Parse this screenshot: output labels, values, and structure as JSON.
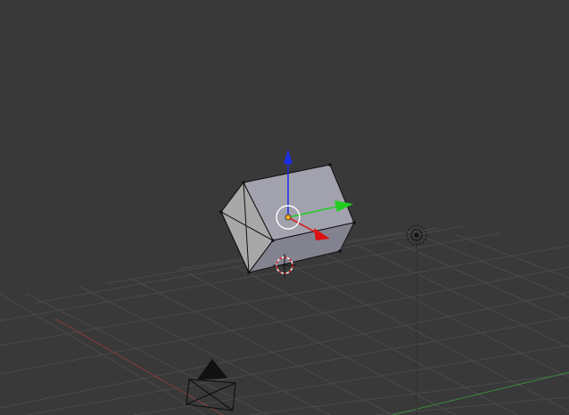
{
  "viewport": {
    "background": "#393939",
    "grid_color": "#4a4a4a",
    "x_axis_color": "#8a3a3a",
    "y_axis_color": "#3c8a3c",
    "light_line_color": "#2a2a2a"
  },
  "mesh": {
    "name": "cube-mesh",
    "face_top_color": "#9a9aa4",
    "face_left_color": "#b0b0b0",
    "face_front_color": "#8e8e94",
    "face_bottom_color": "#707078",
    "edge_color": "#111111"
  },
  "gizmo": {
    "x_color": "#dd1111",
    "y_color": "#22cc22",
    "z_color": "#1a2ee6",
    "pivot_color": "#ffaa22"
  },
  "icons": {
    "cursor": "3d-cursor-icon",
    "lamp": "lamp-icon",
    "camera": "camera-icon"
  }
}
